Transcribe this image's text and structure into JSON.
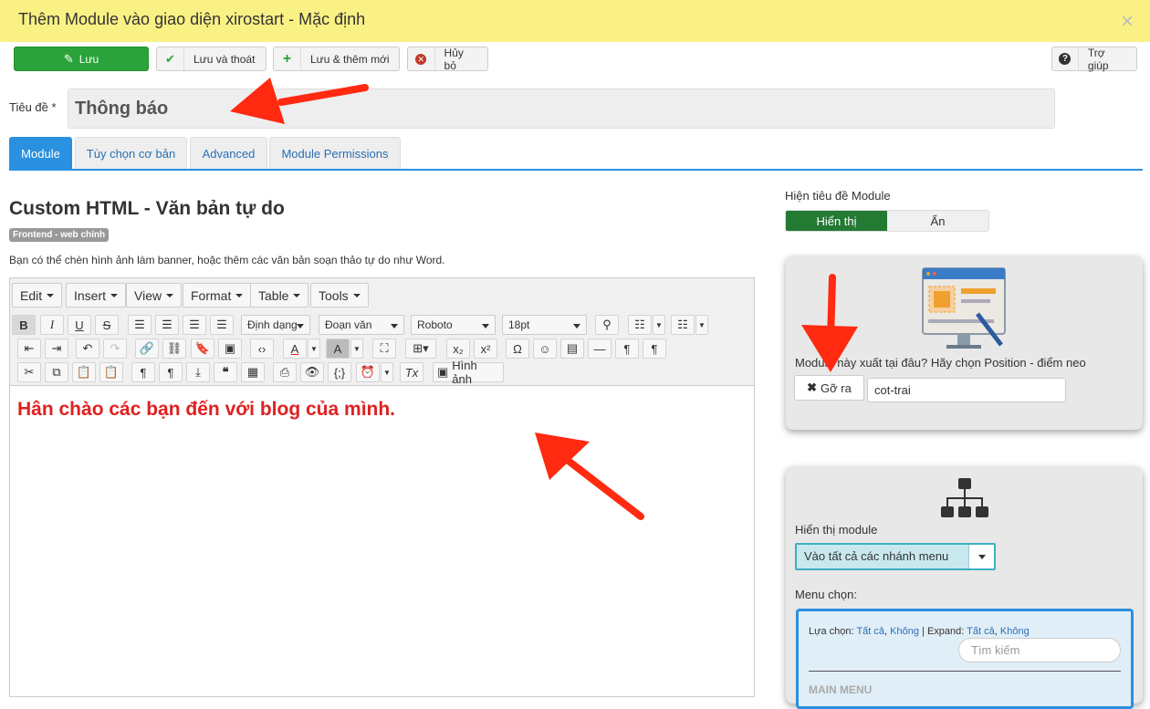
{
  "window": {
    "title": "Thêm Module vào giao diện xirostart - Mặc định",
    "close": "×"
  },
  "toolbar": {
    "save": "Lưu",
    "save_close": "Lưu và thoát",
    "save_new": "Lưu & thêm mới",
    "cancel": "Hủy bỏ",
    "help": "Trợ giúp"
  },
  "form": {
    "title_label": "Tiêu đề *",
    "title_value": "Thông báo"
  },
  "tabs": [
    "Module",
    "Tùy chọn cơ bản",
    "Advanced",
    "Module Permissions"
  ],
  "module": {
    "heading": "Custom HTML - Văn bản tự do",
    "badge": "Frontend - web chính",
    "description": "Bạn có thể chèn hình ảnh làm banner, hoặc thêm các văn bản soạn thảo tự do như Word."
  },
  "editor": {
    "menus": [
      "Edit",
      "Insert",
      "View",
      "Format",
      "Table",
      "Tools"
    ],
    "format_dd": "Định dạng",
    "block_dd": "Đoạn văn",
    "font_dd": "Roboto",
    "size_dd": "18pt",
    "image_btn": "Hình ảnh",
    "content": "Hân chào các bạn đến với blog của mình."
  },
  "sidebar": {
    "show_title_label": "Hiện tiêu đề Module",
    "show": "Hiển thị",
    "hide": "Ẩn",
    "position_question": "Module này xuất tại đâu? Hãy chọn Position - điểm neo",
    "remove_btn": "Gỡ ra",
    "position_value": "cot-trai",
    "display_label": "Hiển thị module",
    "display_value": "Vào tất cả các nhánh menu",
    "menu_label": "Menu chọn:",
    "select_prefix": "Lựa chọn:",
    "all": "Tất cả",
    "none": "Không",
    "expand_prefix": "Expand:",
    "search_placeholder": "Tìm kiếm",
    "root": "MAIN MENU"
  },
  "colors": {
    "accent": "#2a90e0",
    "save": "#2aa43a",
    "annotation": "#ff2a10",
    "titlebar": "#faf184"
  }
}
